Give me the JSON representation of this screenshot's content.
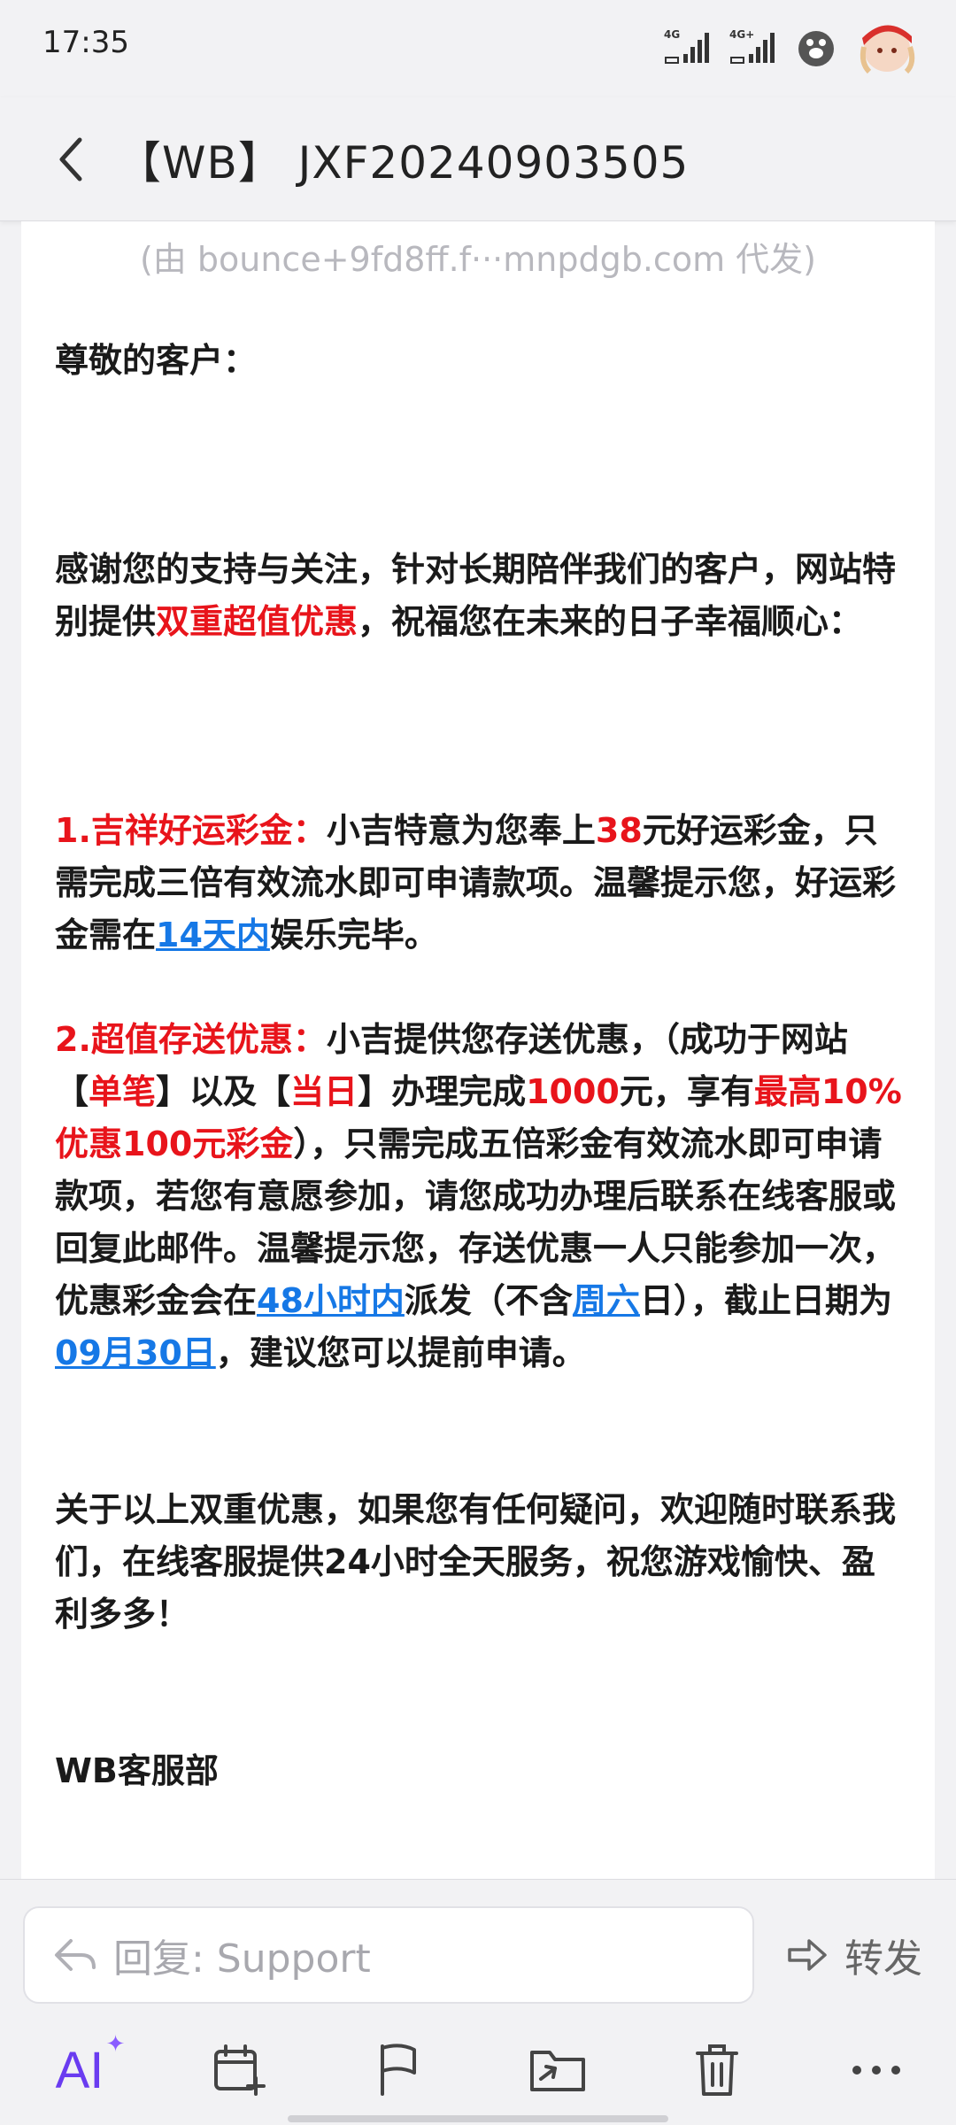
{
  "status_bar": {
    "time": "17:35",
    "icons": [
      "4g-signal-icon",
      "4g-plus-signal-icon",
      "paw-icon",
      "avatar-icon"
    ]
  },
  "header": {
    "subject": "【WB】 JXF20240903505"
  },
  "email": {
    "sender_note": "(由 bounce+9fd8ff.f···mnpdgb.com 代发)",
    "greeting": "尊敬的客户：",
    "intro": {
      "part1": "感谢您的支持与关注，针对长期陪伴我们的客户，网站特别提供",
      "highlight": "双重超值优惠",
      "part2": "，祝福您在未来的日子幸福顺心："
    },
    "offer1": {
      "title": "1.吉祥好运彩金：",
      "part1": "小吉特意为您奉上",
      "amount": "38",
      "part2": "元好运彩金，只需完成三倍有效流水即可申请款项。温馨提示您，好运彩金需在",
      "deadline_link": "14天内",
      "part3": "娱乐完毕。"
    },
    "offer2": {
      "title": "2.超值存送优惠：",
      "part1": "小吉提供您存送优惠，（成功于网站【",
      "single": "单笔",
      "part2": "】以及【",
      "same_day": "当日",
      "part3": "】办理完成",
      "amount": "1000",
      "part4": "元，享有",
      "max_bonus": "最高10%优惠100元彩金",
      "part5": "），只需完成五倍彩金有效流水即可申请款项，若您有意愿参加，请您成功办理后联系在线客服或回复此邮件。温馨提示您，存送优惠一人只能参加一次，优惠彩金会在",
      "hours_link": "48小时内",
      "part6": "派发（不含",
      "saturday_link": "周六",
      "part7": "日），截止日期为",
      "date_link": "09月30日",
      "part8": "，建议您可以提前申请。"
    },
    "closing": "关于以上双重优惠，如果您有任何疑问，欢迎随时联系我们，在线客服提供24小时全天服务，祝您游戏愉快、盈利多多！",
    "signature": "WB客服部"
  },
  "reply_bar": {
    "reply_placeholder": "回复: Support",
    "forward_label": "转发",
    "ai_label": "AI"
  },
  "toolbar": {
    "icons": [
      "ai-icon",
      "calendar-add-icon",
      "flag-icon",
      "move-icon",
      "trash-icon",
      "more-icon"
    ]
  },
  "colors": {
    "highlight_red": "#e8141b",
    "link_blue": "#1678e6",
    "ai_purple": "#6a3cf0"
  }
}
